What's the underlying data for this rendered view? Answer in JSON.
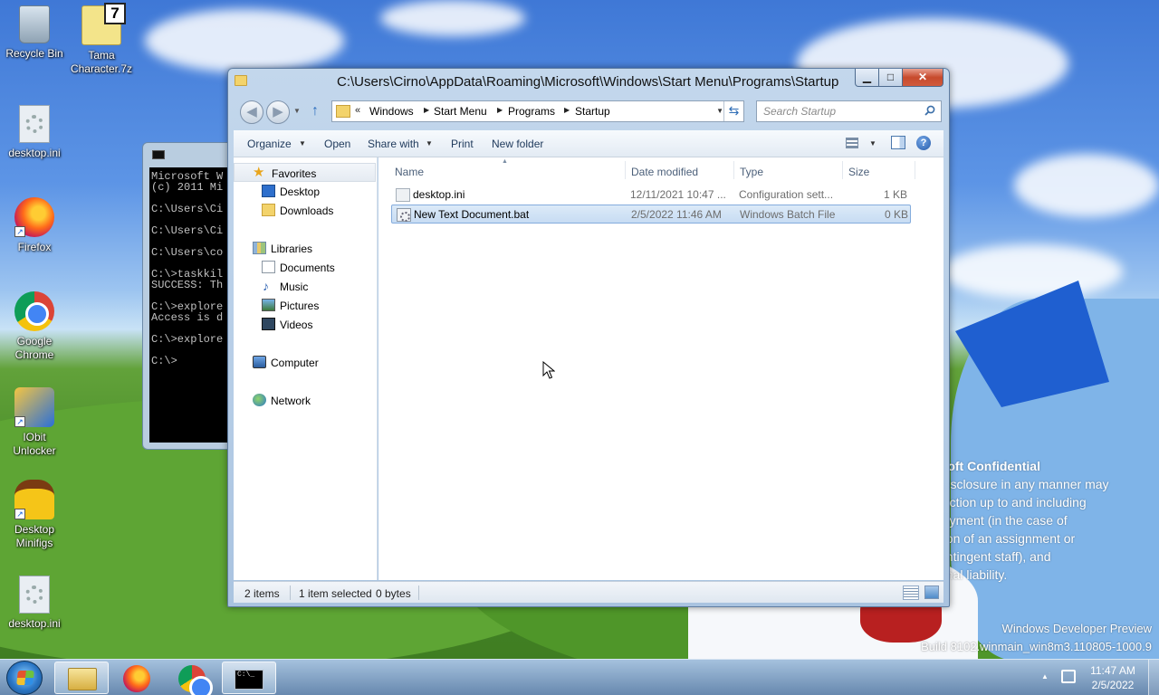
{
  "desktop": {
    "icons": [
      {
        "label": "Recycle Bin",
        "icon": "recycle-bin-icon"
      },
      {
        "label": "Tama Character.7z",
        "icon": "7z-archive-icon",
        "badge": "7"
      },
      {
        "label": "desktop.ini",
        "icon": "settings-file-icon"
      },
      {
        "label": "Firefox",
        "icon": "firefox-icon"
      },
      {
        "label": "Google Chrome",
        "icon": "chrome-icon"
      },
      {
        "label": "IObit Unlocker",
        "icon": "iobit-unlocker-icon"
      },
      {
        "label": "Desktop Minifigs",
        "icon": "minifig-icon"
      },
      {
        "label": "desktop.ini",
        "icon": "settings-file-icon"
      }
    ],
    "watermark": {
      "title": "osoft Confidential",
      "lines": [
        "r disclosure in any manner may",
        "y action up to and including",
        "ployment (in the case of",
        "ation of an assignment or",
        "contingent staff), and",
        "minal liability."
      ]
    },
    "build": {
      "line1": "Windows Developer Preview",
      "line2": "Build 8102.winmain_win8m3.110805-1000.9"
    }
  },
  "console": {
    "lines": [
      "Microsoft W",
      "(c) 2011 Mi",
      "",
      "C:\\Users\\Ci",
      "",
      "C:\\Users\\Ci",
      "",
      "C:\\Users\\co",
      "",
      "C:\\>taskkil",
      "SUCCESS: Th",
      "",
      "C:\\>explore",
      "Access is d",
      "",
      "C:\\>explore",
      "",
      "C:\\>"
    ]
  },
  "explorer": {
    "title": "C:\\Users\\Cirno\\AppData\\Roaming\\Microsoft\\Windows\\Start Menu\\Programs\\Startup",
    "caption": {
      "minimize": "▁",
      "maximize": "□",
      "close": "✕"
    },
    "breadcrumb": {
      "overflow": "«",
      "items": [
        "Windows",
        "Start Menu",
        "Programs",
        "Startup"
      ]
    },
    "search": {
      "placeholder": "Search Startup"
    },
    "toolbar": {
      "organize": "Organize",
      "open": "Open",
      "share_with": "Share with",
      "print": "Print",
      "new_folder": "New folder",
      "help": "?"
    },
    "nav_pane": {
      "favorites": {
        "label": "Favorites",
        "items": [
          "Desktop",
          "Downloads"
        ]
      },
      "libraries": {
        "label": "Libraries",
        "items": [
          "Documents",
          "Music",
          "Pictures",
          "Videos"
        ]
      },
      "computer": "Computer",
      "network": "Network"
    },
    "columns": [
      "Name",
      "Date modified",
      "Type",
      "Size"
    ],
    "files": [
      {
        "name": "desktop.ini",
        "date": "12/11/2021 10:47 ...",
        "type": "Configuration sett...",
        "size": "1 KB",
        "selected": false
      },
      {
        "name": "New Text Document.bat",
        "date": "2/5/2022 11:46 AM",
        "type": "Windows Batch File",
        "size": "0 KB",
        "selected": true
      }
    ],
    "status": {
      "items_count": "2 items",
      "selection": "1 item selected",
      "size": "0 bytes"
    }
  },
  "taskbar": {
    "buttons": [
      "windows-explorer",
      "firefox",
      "chrome",
      "command-prompt"
    ],
    "cmd_glyph": "C:\\_",
    "clock": {
      "time": "11:47 AM",
      "date": "2/5/2022"
    }
  }
}
